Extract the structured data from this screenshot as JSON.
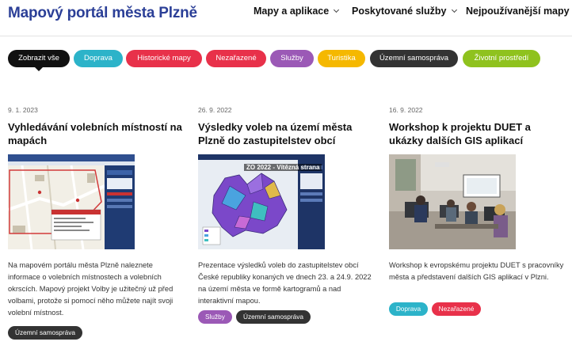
{
  "header": {
    "logo": "Mapový portál města Plzně",
    "nav": [
      {
        "label": "Mapy a aplikace"
      },
      {
        "label": "Poskytované služby"
      },
      {
        "label": "Nejpoužívanější mapy"
      }
    ]
  },
  "filters": [
    {
      "label": "Zobrazit vše",
      "color": "#111111",
      "active": true
    },
    {
      "label": "Doprava",
      "color": "#2cb3c9"
    },
    {
      "label": "Historické mapy",
      "color": "#e8314a"
    },
    {
      "label": "Nezařazené",
      "color": "#e8314a"
    },
    {
      "label": "Služby",
      "color": "#9b59b6"
    },
    {
      "label": "Turistika",
      "color": "#f5b800"
    },
    {
      "label": "Územní samospráva",
      "color": "#333333"
    },
    {
      "label": "Životní prostředí",
      "color": "#8fc21e"
    }
  ],
  "cards": [
    {
      "date": "9. 1. 2023",
      "title": "Vyhledávání volebních místností na mapách",
      "description": "Na mapovém portálu města Plzně naleznete informace o volebních místnostech a volebních okrscích. Mapový projekt Volby je užitečný už před volbami, protože si pomocí něho můžete najít svoji volební místnost.",
      "image_text": "",
      "tags": [
        {
          "label": "Územní samospráva",
          "color": "#333333"
        }
      ]
    },
    {
      "date": "26. 9. 2022",
      "title": "Výsledky voleb na území města Plzně do zastupitelstev obcí",
      "description": "Prezentace výsledků voleb do zastupitelstev obcí České republiky konaných ve dnech 23. a 24.9. 2022 na území města ve formě kartogramů a nad interaktivní mapou.",
      "image_text": "ZO 2022 - Vítězná strana",
      "tags": [
        {
          "label": "Služby",
          "color": "#9b59b6"
        },
        {
          "label": "Územní samospráva",
          "color": "#333333"
        }
      ]
    },
    {
      "date": "16. 9. 2022",
      "title": "Workshop k projektu DUET a ukázky dalších GIS aplikací",
      "description": "Workshop k evropskému projektu DUET s pracovníky města a představení dalších GIS aplikací v Plzni.",
      "image_text": "",
      "tags": [
        {
          "label": "Doprava",
          "color": "#2cb3c9"
        },
        {
          "label": "Nezařazené",
          "color": "#e8314a"
        }
      ]
    }
  ]
}
